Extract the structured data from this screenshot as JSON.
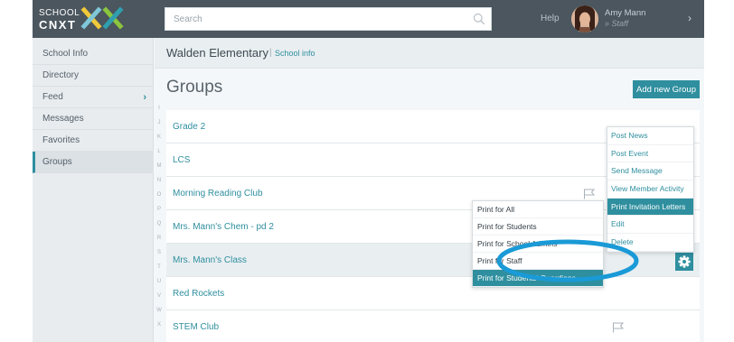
{
  "app": {
    "logo_top": "SCHOOL",
    "logo_bottom": "CNXT"
  },
  "topbar": {
    "search_placeholder": "Search",
    "search_icon": "search-icon",
    "help_label": "Help",
    "user_name": "Amy Mann",
    "user_role": "Staff",
    "user_menu_icon": "chevron-right-icon"
  },
  "sidebar": {
    "items": [
      {
        "label": "School Info"
      },
      {
        "label": "Directory"
      },
      {
        "label": "Feed"
      },
      {
        "label": "Messages"
      },
      {
        "label": "Favorites"
      },
      {
        "label": "Groups",
        "active": true
      }
    ]
  },
  "header": {
    "school_name": "Walden Elementary",
    "separator": "|",
    "school_info_link": "School info"
  },
  "main": {
    "title": "Groups",
    "add_group_label": "Add new Group",
    "alphabet": [
      "I",
      "J",
      "K",
      "L",
      "M",
      "N",
      "O",
      "P",
      "Q",
      "R",
      "S",
      "T",
      "U",
      "V",
      "W",
      "X"
    ],
    "groups": [
      {
        "name": "Grade 2"
      },
      {
        "name": "LCS"
      },
      {
        "name": "Morning Reading Club",
        "flag": true
      },
      {
        "name": "Mrs. Mann's Chem - pd 2"
      },
      {
        "name": "Mrs. Mann's Class",
        "highlighted": true
      },
      {
        "name": "Red Rockets"
      },
      {
        "name": "STEM Club",
        "flag": true
      }
    ]
  },
  "context_menu": {
    "items": [
      {
        "label": "Post News"
      },
      {
        "label": "Post Event"
      },
      {
        "label": "Send Message"
      },
      {
        "label": "View Member Activity"
      },
      {
        "label": "Print Invitation Letters",
        "selected": true
      },
      {
        "label": "Edit"
      },
      {
        "label": "Delete"
      }
    ]
  },
  "print_menu": {
    "items": [
      {
        "label": "Print for All"
      },
      {
        "label": "Print for Students"
      },
      {
        "label": "Print for School Admins"
      },
      {
        "label": "Print for Staff"
      },
      {
        "label": "Print for Students' Guardians",
        "selected": true
      }
    ]
  },
  "colors": {
    "accent": "#2f8f9f",
    "topbar": "#4b565f",
    "annotation": "#1a9ad6"
  }
}
